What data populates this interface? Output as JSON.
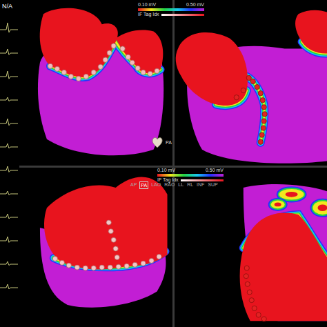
{
  "ecg_strip": {
    "label": "N/A",
    "traces": [
      {
        "level": 0.5
      },
      {
        "level": 0.3
      },
      {
        "level": 0.4
      },
      {
        "level": 0.2
      },
      {
        "level": 0.35
      },
      {
        "level": 0.25
      },
      {
        "level": 0.3
      },
      {
        "level": 0.2
      },
      {
        "level": 0.25
      },
      {
        "level": 0.3
      },
      {
        "level": 0.2
      },
      {
        "level": 0.25
      }
    ]
  },
  "legends": [
    {
      "min": "0.10 mV",
      "max": "0.50 mV",
      "tag_label": "IF Tag Idx"
    },
    {
      "min": "0.10 mV",
      "max": "0.50 mV",
      "tag_label": "IF Tag Idx"
    }
  ],
  "orientation": {
    "current": "PA",
    "views": [
      {
        "label": "AP",
        "selected": false
      },
      {
        "label": "PA",
        "selected": true
      },
      {
        "label": "LAO",
        "selected": false
      },
      {
        "label": "RAO",
        "selected": false
      },
      {
        "label": "LL",
        "selected": false
      },
      {
        "label": "RL",
        "selected": false
      },
      {
        "label": "INF",
        "selected": false
      },
      {
        "label": "SUP",
        "selected": false
      }
    ]
  },
  "panels": [
    {
      "name": "posterior-view",
      "tag_color": "#f2bcbc"
    },
    {
      "name": "posterior-oblique-view",
      "tag_color": "#e32222"
    },
    {
      "name": "inferior-view",
      "tag_color": "#f3c6c6"
    },
    {
      "name": "septal-view",
      "tag_color": "#e32222"
    }
  ]
}
